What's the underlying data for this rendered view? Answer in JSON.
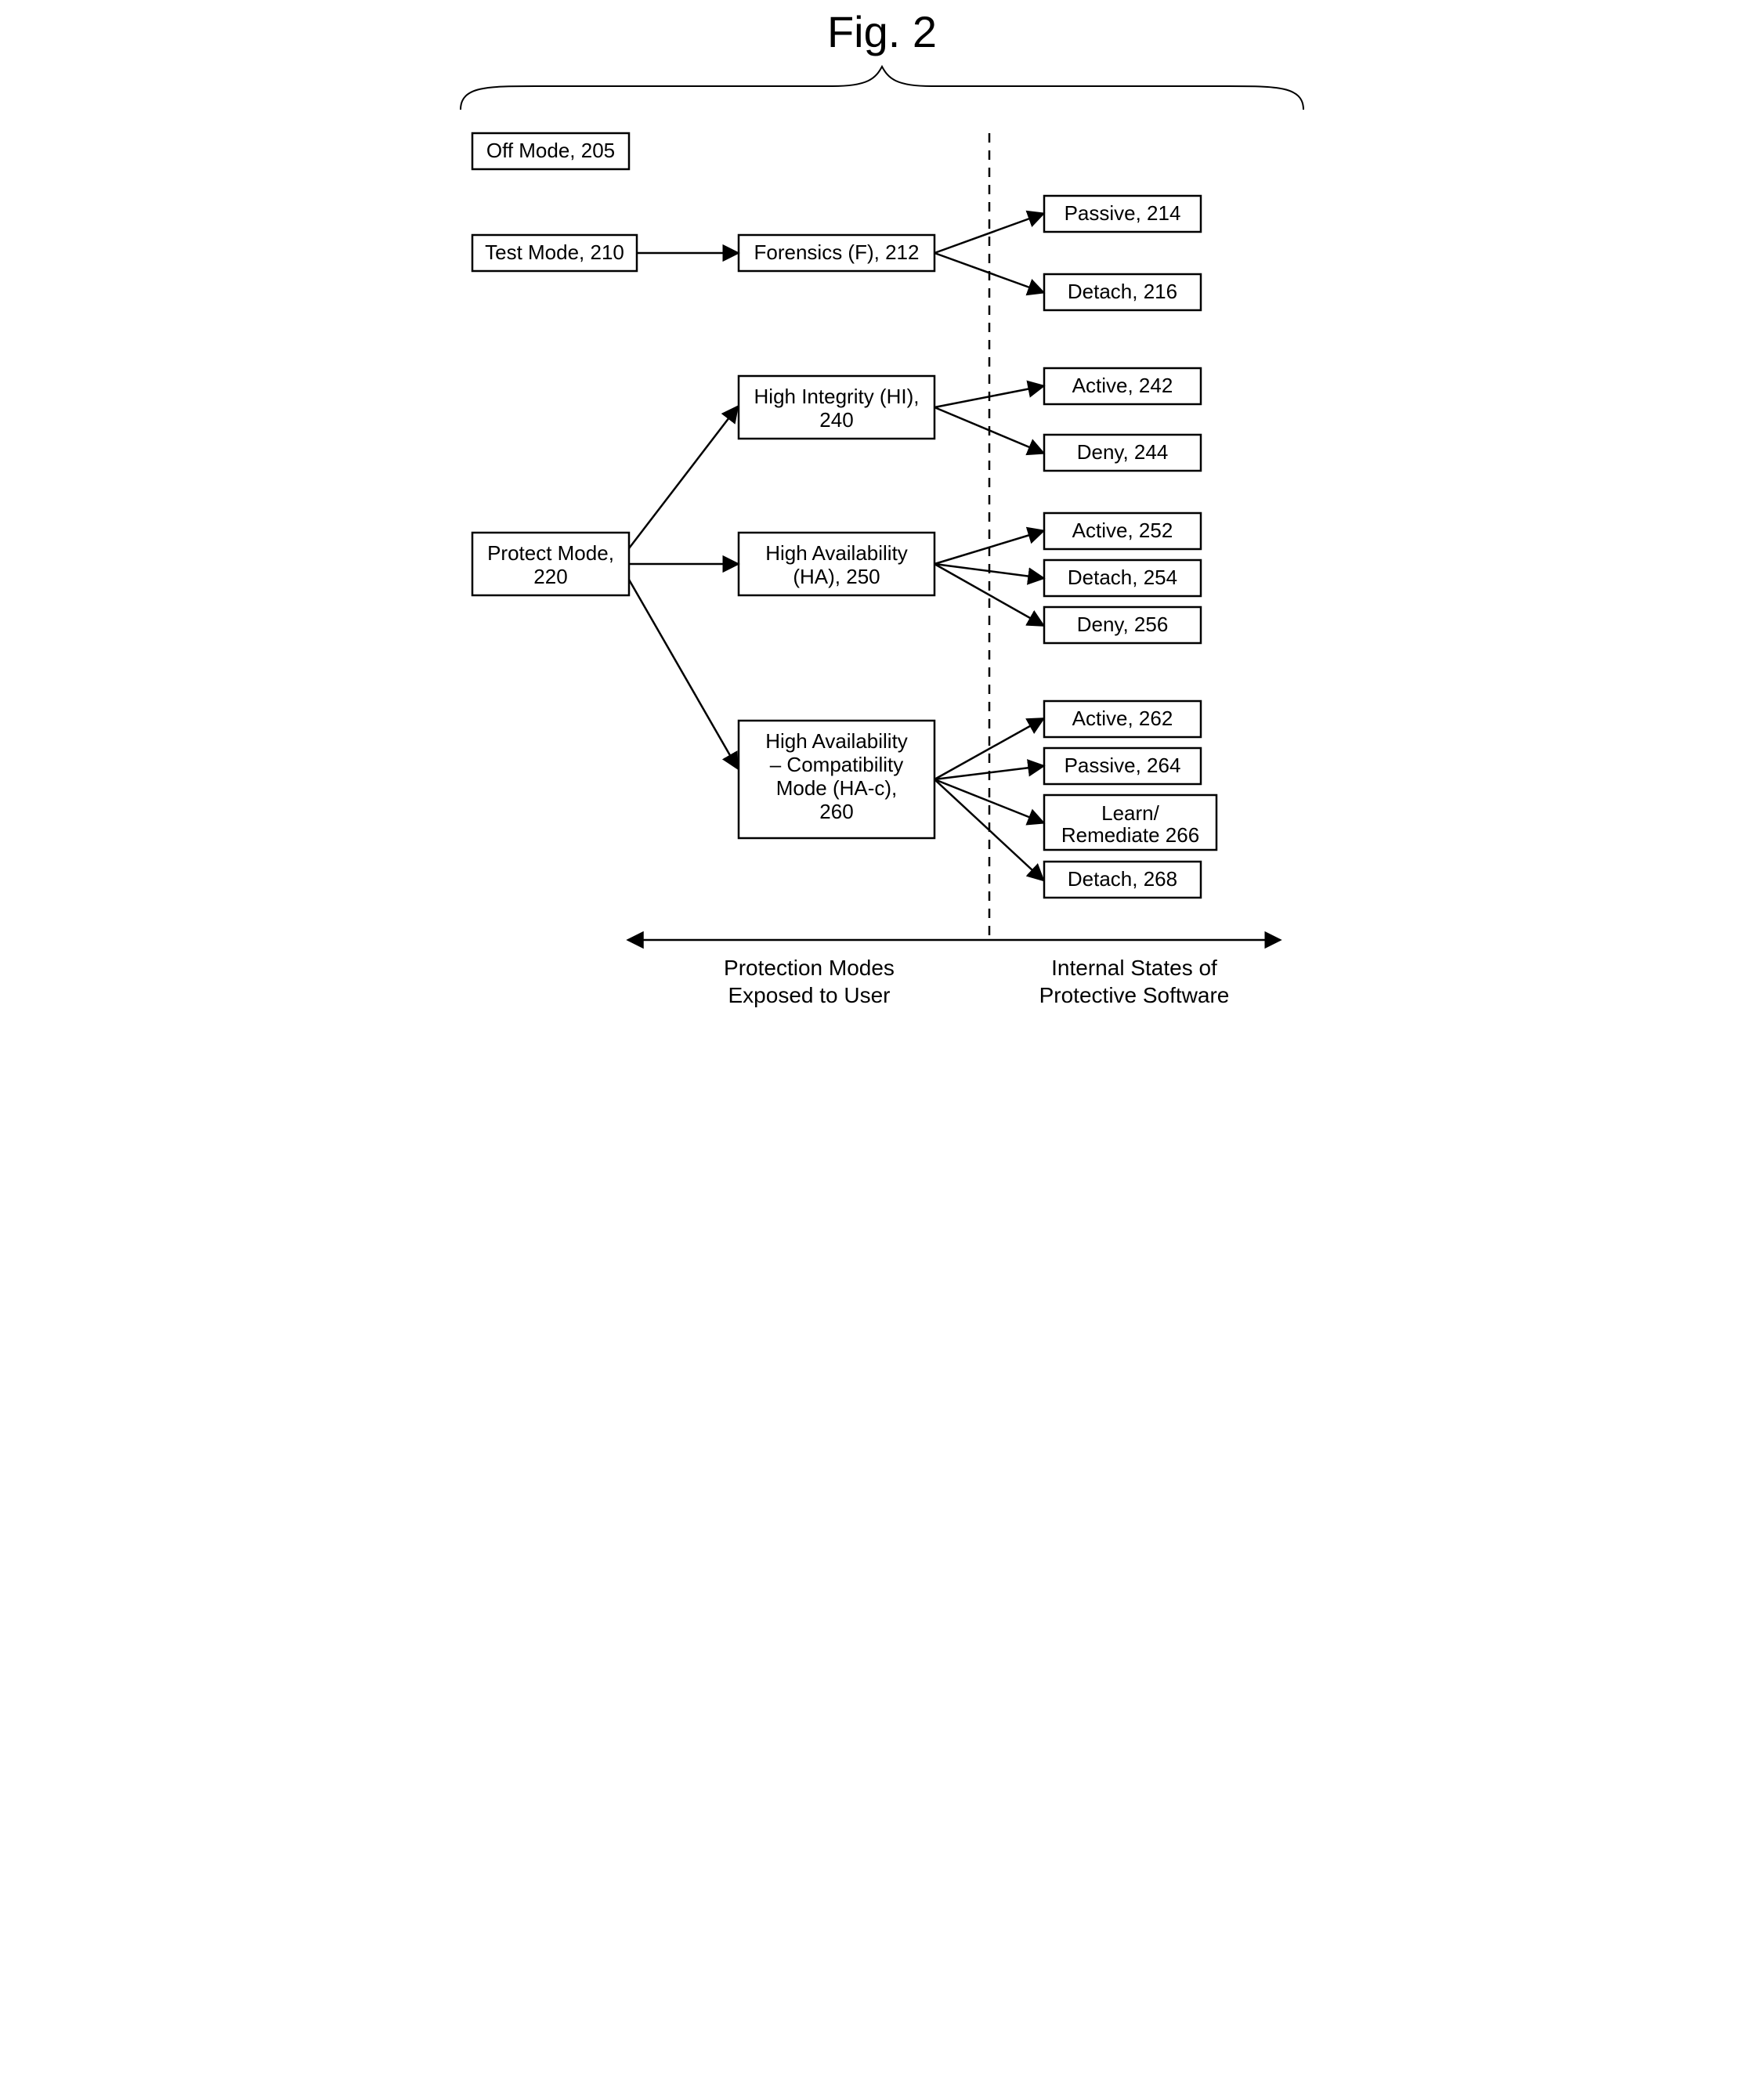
{
  "figure_title": "Fig. 2",
  "nodes": {
    "off": {
      "label": "Off Mode, 205"
    },
    "test": {
      "label": "Test Mode, 210"
    },
    "protect": {
      "label1": "Protect Mode,",
      "label2": "220"
    },
    "forensics": {
      "label": "Forensics (F), 212"
    },
    "hi": {
      "label1": "High Integrity (HI),",
      "label2": "240"
    },
    "ha": {
      "label1": "High Availability",
      "label2": "(HA), 250"
    },
    "hac": {
      "label1": "High Availability",
      "label2": "– Compatibility",
      "label3": "Mode (HA-c),",
      "label4": "260"
    },
    "passive214": {
      "label": "Passive, 214"
    },
    "detach216": {
      "label": "Detach, 216"
    },
    "active242": {
      "label": "Active, 242"
    },
    "deny244": {
      "label": "Deny, 244"
    },
    "active252": {
      "label": "Active, 252"
    },
    "detach254": {
      "label": "Detach, 254"
    },
    "deny256": {
      "label": "Deny, 256"
    },
    "active262": {
      "label": "Active, 262"
    },
    "passive264": {
      "label": "Passive, 264"
    },
    "learn266a": {
      "label": "Learn/"
    },
    "learn266b": {
      "label": "Remediate 266"
    },
    "detach268": {
      "label": "Detach, 268"
    }
  },
  "captions": {
    "left1": "Protection Modes",
    "left2": "Exposed to User",
    "right1": "Internal States of",
    "right2": "Protective Software"
  }
}
